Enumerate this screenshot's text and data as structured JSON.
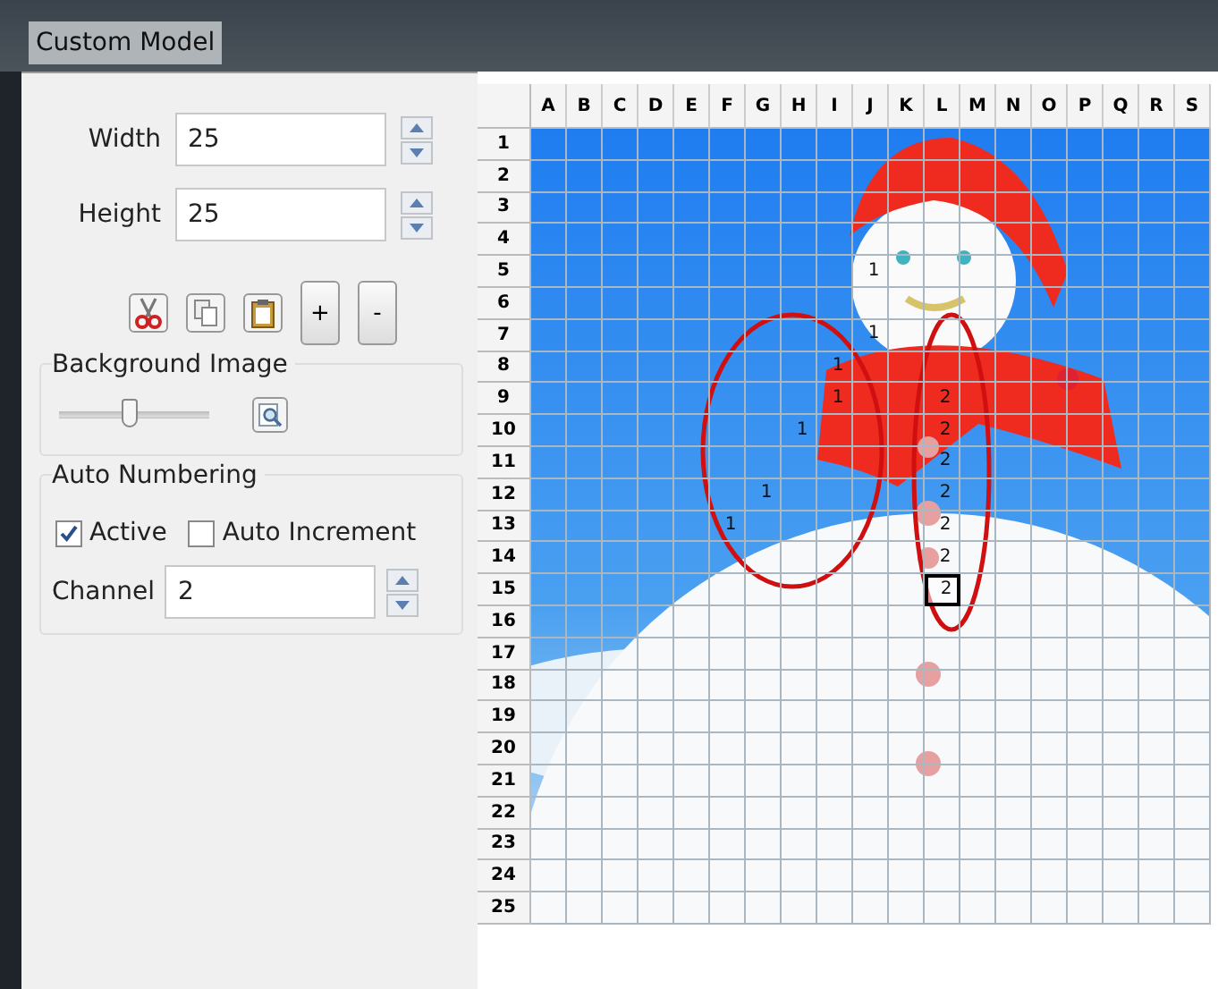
{
  "window": {
    "title": "Custom Model"
  },
  "size": {
    "width": {
      "label": "Width",
      "value": "25"
    },
    "height": {
      "label": "Height",
      "value": "25"
    }
  },
  "toolbar": [
    {
      "kind": "cut"
    },
    {
      "kind": "copy"
    },
    {
      "kind": "paste"
    },
    {
      "kind": "text",
      "label": "+"
    },
    {
      "kind": "text",
      "label": "-"
    }
  ],
  "background_image": {
    "title": "Background Image",
    "opacity": {
      "level": 0.47
    }
  },
  "auto_numbering": {
    "title": "Auto Numbering",
    "options": [
      {
        "label": "Active",
        "checked": true
      },
      {
        "label": "Auto Increment",
        "checked": false
      }
    ],
    "channel": {
      "label": "Channel",
      "value": "2"
    }
  },
  "grid": {
    "columns": [
      "A",
      "B",
      "C",
      "D",
      "E",
      "F",
      "G",
      "H",
      "I",
      "J",
      "K",
      "L",
      "M",
      "N",
      "O",
      "P",
      "Q",
      "R",
      "S"
    ],
    "rows": [
      {
        "label": "1",
        "cells": [
          {
            "selected": false
          },
          {
            "selected": false
          },
          {
            "selected": false
          },
          {
            "selected": false
          },
          {
            "selected": false
          },
          {
            "selected": false
          },
          {
            "selected": false
          },
          {
            "selected": false
          },
          {
            "selected": false
          },
          {
            "selected": false
          },
          {
            "selected": false
          },
          {
            "selected": false
          },
          {
            "selected": false
          },
          {
            "selected": false
          },
          {
            "selected": false
          },
          {
            "selected": false
          },
          {
            "selected": false
          },
          {
            "selected": false
          },
          {
            "selected": false
          }
        ]
      },
      {
        "label": "2",
        "cells": [
          {
            "selected": false
          },
          {
            "selected": false
          },
          {
            "selected": false
          },
          {
            "selected": false
          },
          {
            "selected": false
          },
          {
            "selected": false
          },
          {
            "selected": false
          },
          {
            "selected": false
          },
          {
            "selected": false
          },
          {
            "selected": false
          },
          {
            "selected": false
          },
          {
            "selected": false
          },
          {
            "selected": false
          },
          {
            "selected": false
          },
          {
            "selected": false
          },
          {
            "selected": false
          },
          {
            "selected": false
          },
          {
            "selected": false
          },
          {
            "selected": false
          }
        ]
      },
      {
        "label": "3",
        "cells": [
          {
            "selected": false
          },
          {
            "selected": false
          },
          {
            "selected": false
          },
          {
            "selected": false
          },
          {
            "selected": false
          },
          {
            "selected": false
          },
          {
            "selected": false
          },
          {
            "selected": false
          },
          {
            "selected": false
          },
          {
            "selected": false
          },
          {
            "selected": false
          },
          {
            "selected": false
          },
          {
            "selected": false
          },
          {
            "selected": false
          },
          {
            "selected": false
          },
          {
            "selected": false
          },
          {
            "selected": false
          },
          {
            "selected": false
          },
          {
            "selected": false
          }
        ]
      },
      {
        "label": "4",
        "cells": [
          {
            "selected": false
          },
          {
            "selected": false
          },
          {
            "selected": false
          },
          {
            "selected": false
          },
          {
            "selected": false
          },
          {
            "selected": false
          },
          {
            "selected": false
          },
          {
            "selected": false
          },
          {
            "selected": false
          },
          {
            "selected": false
          },
          {
            "selected": false
          },
          {
            "selected": false
          },
          {
            "selected": false
          },
          {
            "selected": false
          },
          {
            "selected": false
          },
          {
            "selected": false
          },
          {
            "selected": false
          },
          {
            "selected": false
          },
          {
            "selected": false
          }
        ]
      },
      {
        "label": "5",
        "cells": [
          {
            "selected": false
          },
          {
            "selected": false
          },
          {
            "selected": false
          },
          {
            "selected": false
          },
          {
            "selected": false
          },
          {
            "selected": false
          },
          {
            "selected": false
          },
          {
            "selected": false
          },
          {
            "selected": false
          },
          {
            "text": "1",
            "selected": false
          },
          {
            "selected": false
          },
          {
            "selected": false
          },
          {
            "selected": false
          },
          {
            "selected": false
          },
          {
            "selected": false
          },
          {
            "selected": false
          },
          {
            "selected": false
          },
          {
            "selected": false
          },
          {
            "selected": false
          }
        ]
      },
      {
        "label": "6",
        "cells": [
          {
            "selected": false
          },
          {
            "selected": false
          },
          {
            "selected": false
          },
          {
            "selected": false
          },
          {
            "selected": false
          },
          {
            "selected": false
          },
          {
            "selected": false
          },
          {
            "selected": false
          },
          {
            "selected": false
          },
          {
            "selected": false
          },
          {
            "selected": false
          },
          {
            "selected": false
          },
          {
            "selected": false
          },
          {
            "selected": false
          },
          {
            "selected": false
          },
          {
            "selected": false
          },
          {
            "selected": false
          },
          {
            "selected": false
          },
          {
            "selected": false
          }
        ]
      },
      {
        "label": "7",
        "cells": [
          {
            "selected": false
          },
          {
            "selected": false
          },
          {
            "selected": false
          },
          {
            "selected": false
          },
          {
            "selected": false
          },
          {
            "selected": false
          },
          {
            "selected": false
          },
          {
            "selected": false
          },
          {
            "selected": false
          },
          {
            "text": "1",
            "selected": false
          },
          {
            "selected": false
          },
          {
            "selected": false
          },
          {
            "selected": false
          },
          {
            "selected": false
          },
          {
            "selected": false
          },
          {
            "selected": false
          },
          {
            "selected": false
          },
          {
            "selected": false
          },
          {
            "selected": false
          }
        ]
      },
      {
        "label": "8",
        "cells": [
          {
            "selected": false
          },
          {
            "selected": false
          },
          {
            "selected": false
          },
          {
            "selected": false
          },
          {
            "selected": false
          },
          {
            "selected": false
          },
          {
            "selected": false
          },
          {
            "selected": false
          },
          {
            "text": "1",
            "selected": false
          },
          {
            "selected": false
          },
          {
            "selected": false
          },
          {
            "selected": false
          },
          {
            "selected": false
          },
          {
            "selected": false
          },
          {
            "selected": false
          },
          {
            "selected": false
          },
          {
            "selected": false
          },
          {
            "selected": false
          },
          {
            "selected": false
          }
        ]
      },
      {
        "label": "9",
        "cells": [
          {
            "selected": false
          },
          {
            "selected": false
          },
          {
            "selected": false
          },
          {
            "selected": false
          },
          {
            "selected": false
          },
          {
            "selected": false
          },
          {
            "selected": false
          },
          {
            "selected": false
          },
          {
            "text": "1",
            "selected": false
          },
          {
            "selected": false
          },
          {
            "selected": false
          },
          {
            "text": "2",
            "selected": false
          },
          {
            "selected": false
          },
          {
            "selected": false
          },
          {
            "selected": false
          },
          {
            "selected": false
          },
          {
            "selected": false
          },
          {
            "selected": false
          },
          {
            "selected": false
          }
        ]
      },
      {
        "label": "10",
        "cells": [
          {
            "selected": false
          },
          {
            "selected": false
          },
          {
            "selected": false
          },
          {
            "selected": false
          },
          {
            "selected": false
          },
          {
            "selected": false
          },
          {
            "selected": false
          },
          {
            "text": "1",
            "selected": false
          },
          {
            "selected": false
          },
          {
            "selected": false
          },
          {
            "selected": false
          },
          {
            "text": "2",
            "selected": false
          },
          {
            "selected": false
          },
          {
            "selected": false
          },
          {
            "selected": false
          },
          {
            "selected": false
          },
          {
            "selected": false
          },
          {
            "selected": false
          },
          {
            "selected": false
          }
        ]
      },
      {
        "label": "11",
        "cells": [
          {
            "selected": false
          },
          {
            "selected": false
          },
          {
            "selected": false
          },
          {
            "selected": false
          },
          {
            "selected": false
          },
          {
            "selected": false
          },
          {
            "selected": false
          },
          {
            "selected": false
          },
          {
            "selected": false
          },
          {
            "selected": false
          },
          {
            "selected": false
          },
          {
            "text": "2",
            "selected": false
          },
          {
            "selected": false
          },
          {
            "selected": false
          },
          {
            "selected": false
          },
          {
            "selected": false
          },
          {
            "selected": false
          },
          {
            "selected": false
          },
          {
            "selected": false
          }
        ]
      },
      {
        "label": "12",
        "cells": [
          {
            "selected": false
          },
          {
            "selected": false
          },
          {
            "selected": false
          },
          {
            "selected": false
          },
          {
            "selected": false
          },
          {
            "selected": false
          },
          {
            "text": "1",
            "selected": false
          },
          {
            "selected": false
          },
          {
            "selected": false
          },
          {
            "selected": false
          },
          {
            "selected": false
          },
          {
            "text": "2",
            "selected": false
          },
          {
            "selected": false
          },
          {
            "selected": false
          },
          {
            "selected": false
          },
          {
            "selected": false
          },
          {
            "selected": false
          },
          {
            "selected": false
          },
          {
            "selected": false
          }
        ]
      },
      {
        "label": "13",
        "cells": [
          {
            "selected": false
          },
          {
            "selected": false
          },
          {
            "selected": false
          },
          {
            "selected": false
          },
          {
            "selected": false
          },
          {
            "text": "1",
            "selected": false
          },
          {
            "selected": false
          },
          {
            "selected": false
          },
          {
            "selected": false
          },
          {
            "selected": false
          },
          {
            "selected": false
          },
          {
            "text": "2",
            "selected": false
          },
          {
            "selected": false
          },
          {
            "selected": false
          },
          {
            "selected": false
          },
          {
            "selected": false
          },
          {
            "selected": false
          },
          {
            "selected": false
          },
          {
            "selected": false
          }
        ]
      },
      {
        "label": "14",
        "cells": [
          {
            "selected": false
          },
          {
            "selected": false
          },
          {
            "selected": false
          },
          {
            "selected": false
          },
          {
            "selected": false
          },
          {
            "selected": false
          },
          {
            "selected": false
          },
          {
            "selected": false
          },
          {
            "selected": false
          },
          {
            "selected": false
          },
          {
            "selected": false
          },
          {
            "text": "2",
            "selected": false
          },
          {
            "selected": false
          },
          {
            "selected": false
          },
          {
            "selected": false
          },
          {
            "selected": false
          },
          {
            "selected": false
          },
          {
            "selected": false
          },
          {
            "selected": false
          }
        ]
      },
      {
        "label": "15",
        "cells": [
          {
            "selected": false
          },
          {
            "selected": false
          },
          {
            "selected": false
          },
          {
            "selected": false
          },
          {
            "selected": false
          },
          {
            "selected": false
          },
          {
            "selected": false
          },
          {
            "selected": false
          },
          {
            "selected": false
          },
          {
            "selected": false
          },
          {
            "selected": false
          },
          {
            "text": "2",
            "selected": true
          },
          {
            "selected": false
          },
          {
            "selected": false
          },
          {
            "selected": false
          },
          {
            "selected": false
          },
          {
            "selected": false
          },
          {
            "selected": false
          },
          {
            "selected": false
          }
        ]
      },
      {
        "label": "16",
        "cells": [
          {
            "selected": false
          },
          {
            "selected": false
          },
          {
            "selected": false
          },
          {
            "selected": false
          },
          {
            "selected": false
          },
          {
            "selected": false
          },
          {
            "selected": false
          },
          {
            "selected": false
          },
          {
            "selected": false
          },
          {
            "selected": false
          },
          {
            "selected": false
          },
          {
            "selected": false
          },
          {
            "selected": false
          },
          {
            "selected": false
          },
          {
            "selected": false
          },
          {
            "selected": false
          },
          {
            "selected": false
          },
          {
            "selected": false
          },
          {
            "selected": false
          }
        ]
      },
      {
        "label": "17",
        "cells": [
          {
            "selected": false
          },
          {
            "selected": false
          },
          {
            "selected": false
          },
          {
            "selected": false
          },
          {
            "selected": false
          },
          {
            "selected": false
          },
          {
            "selected": false
          },
          {
            "selected": false
          },
          {
            "selected": false
          },
          {
            "selected": false
          },
          {
            "selected": false
          },
          {
            "selected": false
          },
          {
            "selected": false
          },
          {
            "selected": false
          },
          {
            "selected": false
          },
          {
            "selected": false
          },
          {
            "selected": false
          },
          {
            "selected": false
          },
          {
            "selected": false
          }
        ]
      },
      {
        "label": "18",
        "cells": [
          {
            "selected": false
          },
          {
            "selected": false
          },
          {
            "selected": false
          },
          {
            "selected": false
          },
          {
            "selected": false
          },
          {
            "selected": false
          },
          {
            "selected": false
          },
          {
            "selected": false
          },
          {
            "selected": false
          },
          {
            "selected": false
          },
          {
            "selected": false
          },
          {
            "selected": false
          },
          {
            "selected": false
          },
          {
            "selected": false
          },
          {
            "selected": false
          },
          {
            "selected": false
          },
          {
            "selected": false
          },
          {
            "selected": false
          },
          {
            "selected": false
          }
        ]
      },
      {
        "label": "19",
        "cells": [
          {
            "selected": false
          },
          {
            "selected": false
          },
          {
            "selected": false
          },
          {
            "selected": false
          },
          {
            "selected": false
          },
          {
            "selected": false
          },
          {
            "selected": false
          },
          {
            "selected": false
          },
          {
            "selected": false
          },
          {
            "selected": false
          },
          {
            "selected": false
          },
          {
            "selected": false
          },
          {
            "selected": false
          },
          {
            "selected": false
          },
          {
            "selected": false
          },
          {
            "selected": false
          },
          {
            "selected": false
          },
          {
            "selected": false
          },
          {
            "selected": false
          }
        ]
      },
      {
        "label": "20",
        "cells": [
          {
            "selected": false
          },
          {
            "selected": false
          },
          {
            "selected": false
          },
          {
            "selected": false
          },
          {
            "selected": false
          },
          {
            "selected": false
          },
          {
            "selected": false
          },
          {
            "selected": false
          },
          {
            "selected": false
          },
          {
            "selected": false
          },
          {
            "selected": false
          },
          {
            "selected": false
          },
          {
            "selected": false
          },
          {
            "selected": false
          },
          {
            "selected": false
          },
          {
            "selected": false
          },
          {
            "selected": false
          },
          {
            "selected": false
          },
          {
            "selected": false
          }
        ]
      },
      {
        "label": "21",
        "cells": [
          {
            "selected": false
          },
          {
            "selected": false
          },
          {
            "selected": false
          },
          {
            "selected": false
          },
          {
            "selected": false
          },
          {
            "selected": false
          },
          {
            "selected": false
          },
          {
            "selected": false
          },
          {
            "selected": false
          },
          {
            "selected": false
          },
          {
            "selected": false
          },
          {
            "selected": false
          },
          {
            "selected": false
          },
          {
            "selected": false
          },
          {
            "selected": false
          },
          {
            "selected": false
          },
          {
            "selected": false
          },
          {
            "selected": false
          },
          {
            "selected": false
          }
        ]
      },
      {
        "label": "22",
        "cells": [
          {
            "selected": false
          },
          {
            "selected": false
          },
          {
            "selected": false
          },
          {
            "selected": false
          },
          {
            "selected": false
          },
          {
            "selected": false
          },
          {
            "selected": false
          },
          {
            "selected": false
          },
          {
            "selected": false
          },
          {
            "selected": false
          },
          {
            "selected": false
          },
          {
            "selected": false
          },
          {
            "selected": false
          },
          {
            "selected": false
          },
          {
            "selected": false
          },
          {
            "selected": false
          },
          {
            "selected": false
          },
          {
            "selected": false
          },
          {
            "selected": false
          }
        ]
      },
      {
        "label": "23",
        "cells": [
          {
            "selected": false
          },
          {
            "selected": false
          },
          {
            "selected": false
          },
          {
            "selected": false
          },
          {
            "selected": false
          },
          {
            "selected": false
          },
          {
            "selected": false
          },
          {
            "selected": false
          },
          {
            "selected": false
          },
          {
            "selected": false
          },
          {
            "selected": false
          },
          {
            "selected": false
          },
          {
            "selected": false
          },
          {
            "selected": false
          },
          {
            "selected": false
          },
          {
            "selected": false
          },
          {
            "selected": false
          },
          {
            "selected": false
          },
          {
            "selected": false
          }
        ]
      },
      {
        "label": "24",
        "cells": [
          {
            "selected": false
          },
          {
            "selected": false
          },
          {
            "selected": false
          },
          {
            "selected": false
          },
          {
            "selected": false
          },
          {
            "selected": false
          },
          {
            "selected": false
          },
          {
            "selected": false
          },
          {
            "selected": false
          },
          {
            "selected": false
          },
          {
            "selected": false
          },
          {
            "selected": false
          },
          {
            "selected": false
          },
          {
            "selected": false
          },
          {
            "selected": false
          },
          {
            "selected": false
          },
          {
            "selected": false
          },
          {
            "selected": false
          },
          {
            "selected": false
          }
        ]
      },
      {
        "label": "25",
        "cells": [
          {
            "selected": false
          },
          {
            "selected": false
          },
          {
            "selected": false
          },
          {
            "selected": false
          },
          {
            "selected": false
          },
          {
            "selected": false
          },
          {
            "selected": false
          },
          {
            "selected": false
          },
          {
            "selected": false
          },
          {
            "selected": false
          },
          {
            "selected": false
          },
          {
            "selected": false
          },
          {
            "selected": false
          },
          {
            "selected": false
          },
          {
            "selected": false
          },
          {
            "selected": false
          },
          {
            "selected": false
          },
          {
            "selected": false
          },
          {
            "selected": false
          }
        ]
      }
    ]
  }
}
